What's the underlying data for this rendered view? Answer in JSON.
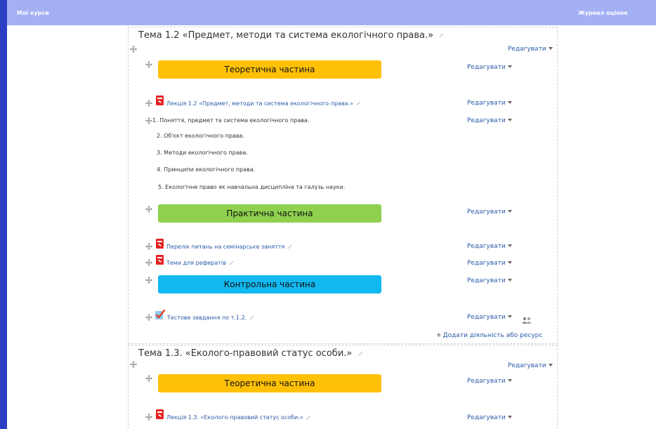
{
  "nav": {
    "my_courses": "Мої курси",
    "gradebook": "Журнал оцінок"
  },
  "edit_label": "Редагувати",
  "add_activity_label": "Додати діяльність або ресурс",
  "colors": {
    "yellow": "#ffc107",
    "green": "#8fd14f",
    "blue": "#12b8f0",
    "link": "#2a5aa8",
    "nav": "#a3b0f4"
  },
  "section1": {
    "title": "Тема 1.2 «Предмет, методи та система екологічного права.»",
    "theory_banner": "Теоретична частина",
    "lecture": "Лекція 1.2 «Предмет, методи та система екологічного права.»",
    "topics": [
      "1. Поняття, предмет та система екологічного права.",
      "2. Об'єкт екологічного права.",
      "3. Методи екологічного права.",
      "4. Принципи екологічного права.",
      "5. Екологічне право як навчальна дисципліна та галузь науки."
    ],
    "practice_banner": "Практична частина",
    "seminar_questions": "Перелік питань на семінарське заняття",
    "essay_topics": "Теми для рефератів",
    "control_banner": "Контрольна частина",
    "test": "Тестове завдання по т.1.2."
  },
  "section2": {
    "title": "Тема 1.3. «Еколого-правовий статус особи.»",
    "theory_banner": "Теоретична частина",
    "lecture": "Лекція 1.3. «Еколого-правовий статус особи.»"
  },
  "icons": {
    "move": "move-icon",
    "edit": "pencil-icon",
    "file": "pdf-file-icon",
    "quiz": "quiz-check-icon",
    "group": "group-icon"
  }
}
